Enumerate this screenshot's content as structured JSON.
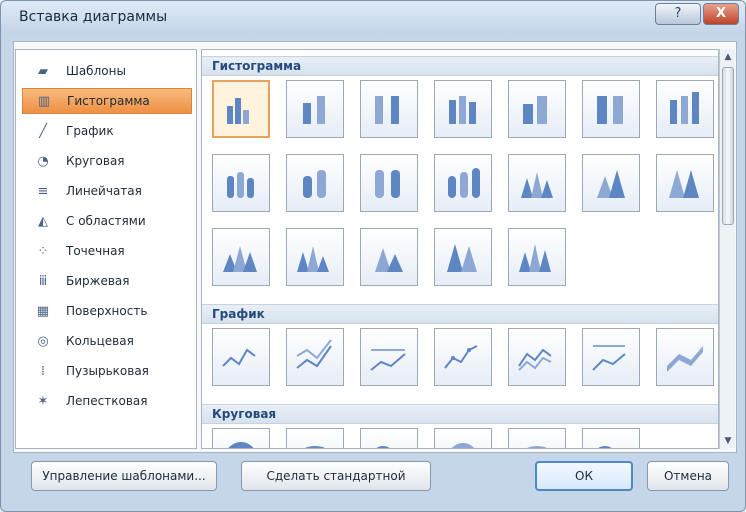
{
  "window": {
    "title": "Вставка диаграммы",
    "help": "?",
    "close": "X"
  },
  "sidebar": {
    "items": [
      {
        "label": "Шаблоны",
        "icon": "folder-icon"
      },
      {
        "label": "Гистограмма",
        "icon": "column-chart-icon",
        "selected": true
      },
      {
        "label": "График",
        "icon": "line-chart-icon"
      },
      {
        "label": "Круговая",
        "icon": "pie-chart-icon"
      },
      {
        "label": "Линейчатая",
        "icon": "bar-chart-icon"
      },
      {
        "label": "С областями",
        "icon": "area-chart-icon"
      },
      {
        "label": "Точечная",
        "icon": "scatter-chart-icon"
      },
      {
        "label": "Биржевая",
        "icon": "stock-chart-icon"
      },
      {
        "label": "Поверхность",
        "icon": "surface-chart-icon"
      },
      {
        "label": "Кольцевая",
        "icon": "donut-chart-icon"
      },
      {
        "label": "Пузырьковая",
        "icon": "bubble-chart-icon"
      },
      {
        "label": "Лепестковая",
        "icon": "radar-chart-icon"
      }
    ]
  },
  "sections": {
    "histogram": {
      "title": "Гистограмма"
    },
    "line": {
      "title": "График"
    },
    "pie": {
      "title": "Круговая"
    }
  },
  "buttons": {
    "manage_templates": "Управление шаблонами...",
    "set_default": "Сделать стандартной",
    "ok": "ОК",
    "cancel": "Отмена"
  },
  "colors": {
    "accent": "#f09b4f",
    "thumb_blue": "#5e86c2"
  }
}
